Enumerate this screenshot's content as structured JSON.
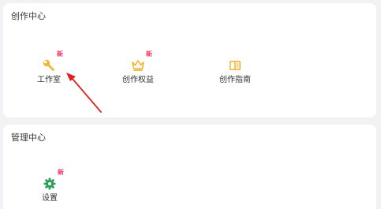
{
  "creation_center": {
    "title": "创作中心",
    "items": [
      {
        "label": "工作室",
        "badge": "新",
        "icon": "wrench-icon",
        "color": "#f2b632"
      },
      {
        "label": "创作权益",
        "badge": "新",
        "icon": "crown-icon",
        "color": "#f2b632"
      },
      {
        "label": "创作指南",
        "badge": "",
        "icon": "book-icon",
        "color": "#f2b632"
      }
    ]
  },
  "management_center": {
    "title": "管理中心",
    "items": [
      {
        "label": "设置",
        "badge": "新",
        "icon": "gear-icon",
        "color": "#2e9e5b"
      }
    ]
  },
  "colors": {
    "badge": "#ff3366",
    "annotation_arrow": "#e02020",
    "background": "#f2f2f4",
    "card": "#ffffff"
  }
}
